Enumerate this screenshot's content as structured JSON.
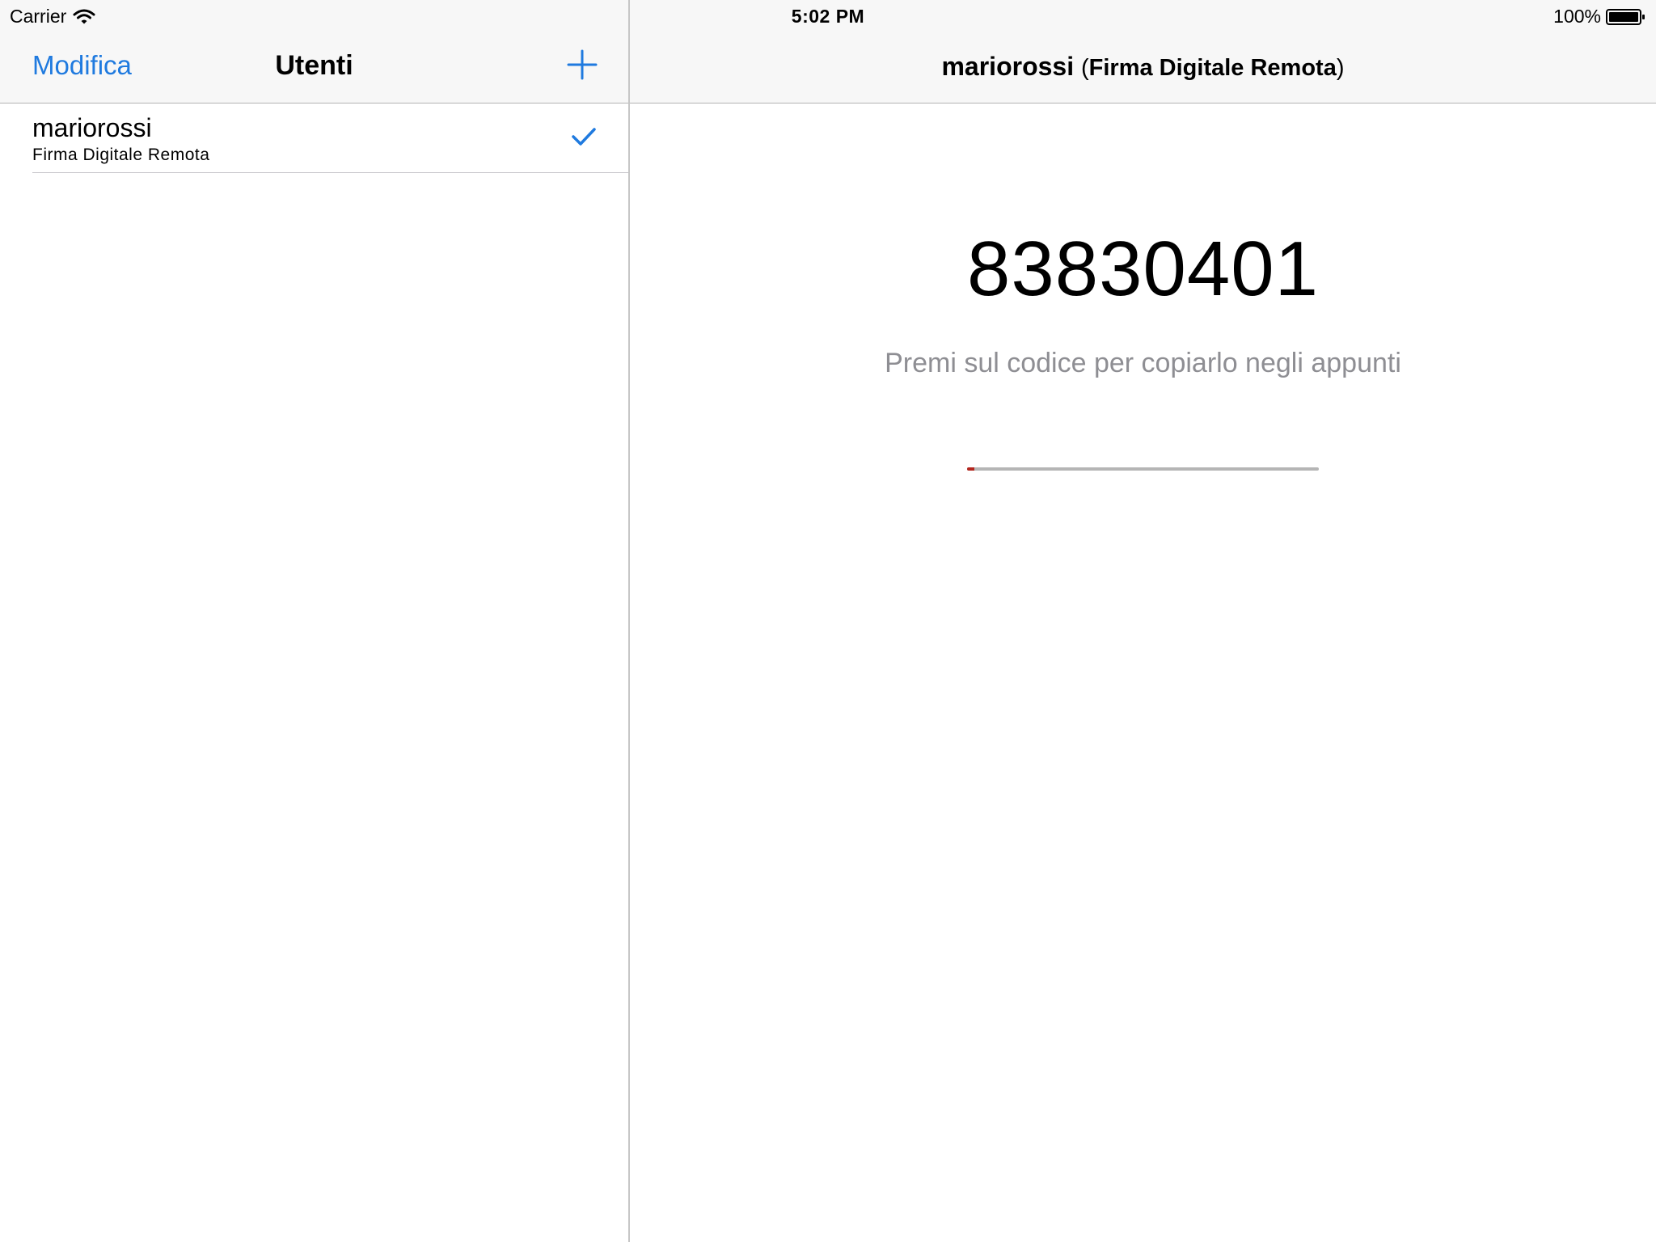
{
  "status_bar": {
    "carrier": "Carrier",
    "time": "5:02 PM",
    "battery": "100%"
  },
  "master": {
    "edit_label": "Modifica",
    "title": "Utenti",
    "add_icon": "plus-icon",
    "users": [
      {
        "name": "mariorossi",
        "type": "Firma Digitale Remota",
        "selected": true
      }
    ]
  },
  "detail": {
    "title_user": "mariorossi",
    "title_open": "(",
    "title_type": "Firma Digitale Remota",
    "title_close": ")",
    "code": "83830401",
    "hint": "Premi sul codice per copiarlo negli appunti",
    "progress_fraction": 0.02
  },
  "colors": {
    "accent": "#1f7adf",
    "progress_fill": "#b3261e",
    "progress_track": "#b5b5b5",
    "hint_text": "#8e8e93",
    "bar_background": "#f7f7f7"
  }
}
